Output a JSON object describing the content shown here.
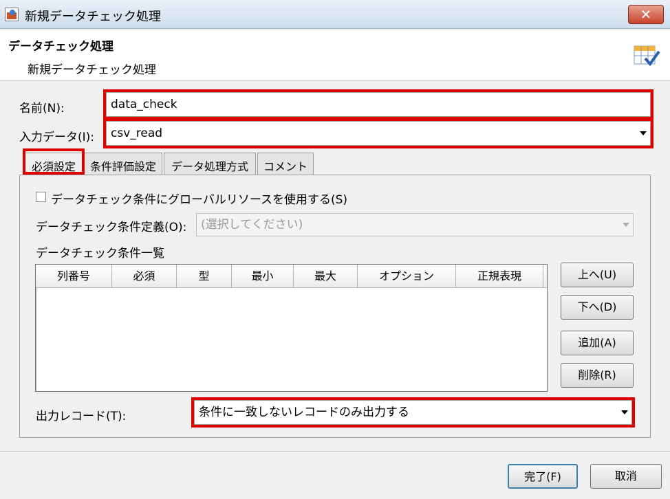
{
  "window": {
    "title": "新規データチェック処理",
    "close": "✕"
  },
  "header": {
    "title": "データチェック処理",
    "subtitle": "新規データチェック処理"
  },
  "form": {
    "name_label": "名前(N):",
    "name_value": "data_check",
    "input_label": "入力データ(I):",
    "input_value": "csv_read"
  },
  "tabs": [
    {
      "label": "必須設定",
      "active": true
    },
    {
      "label": "条件評価設定"
    },
    {
      "label": "データ処理方式"
    },
    {
      "label": "コメント"
    }
  ],
  "panel": {
    "global_checkbox_label": "データチェック条件にグローバルリソースを使用する(S)",
    "global_checked": false,
    "def_label": "データチェック条件定義(O):",
    "def_placeholder": "(選択してください)",
    "list_label": "データチェック条件一覧",
    "columns": [
      "列番号",
      "必須",
      "型",
      "最小",
      "最大",
      "オプション",
      "正規表現"
    ],
    "rows": [],
    "buttons": {
      "up": "上へ(U)",
      "down": "下へ(D)",
      "add": "追加(A)",
      "remove": "削除(R)"
    },
    "output_label": "出力レコード(T):",
    "output_value": "条件に一致しないレコードのみ出力する"
  },
  "footer": {
    "finish": "完了(F)",
    "cancel": "取消"
  },
  "colors": {
    "highlight": "#e00000"
  }
}
